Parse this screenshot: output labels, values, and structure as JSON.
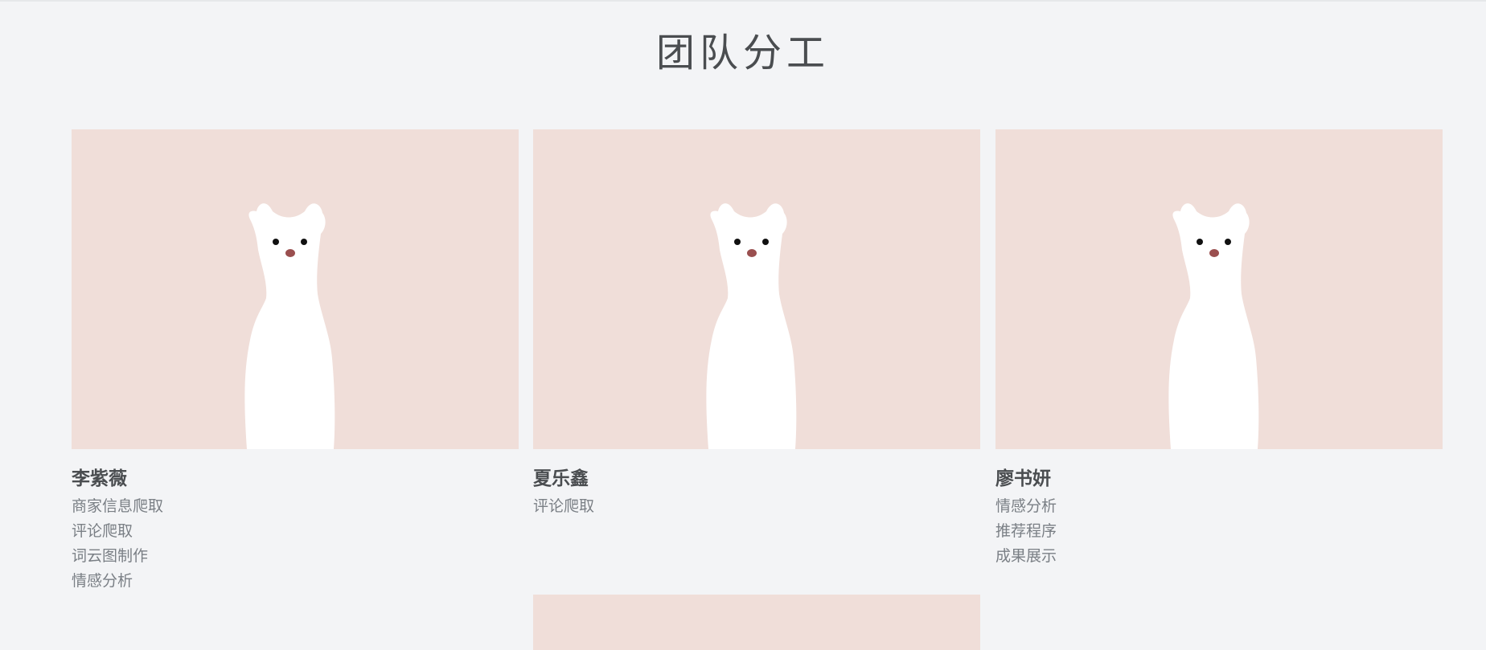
{
  "page": {
    "title": "团队分工"
  },
  "members": [
    {
      "name": "李紫薇",
      "tasks": [
        "商家信息爬取",
        "评论爬取",
        "词云图制作",
        "情感分析"
      ]
    },
    {
      "name": "夏乐鑫",
      "tasks": [
        "评论爬取"
      ]
    },
    {
      "name": "廖书妍",
      "tasks": [
        "情感分析",
        "推荐程序",
        "成果展示"
      ]
    }
  ],
  "colors": {
    "background": "#f3f4f6",
    "card_image_bg": "#f0ded9",
    "title": "#4a4d50",
    "task_text": "#7a7f85",
    "nose": "#9a4f4f"
  },
  "icons": {
    "member_illustration": "ermine-illustration"
  }
}
